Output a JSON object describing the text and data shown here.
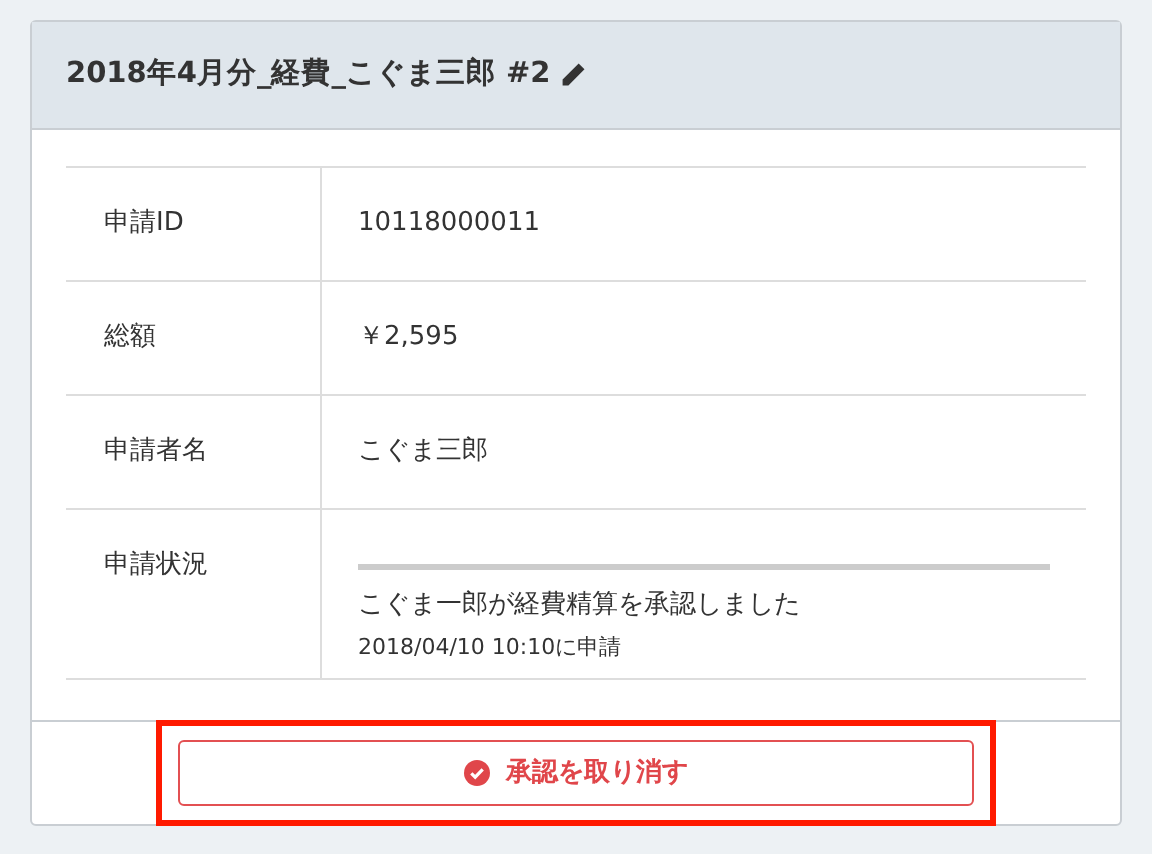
{
  "card": {
    "title": "2018年4月分_経費_こぐま三郎 #2"
  },
  "details": [
    {
      "label": "申請ID",
      "value": "10118000011"
    },
    {
      "label": "総額",
      "value": "￥2,595"
    },
    {
      "label": "申請者名",
      "value": "こぐま三郎"
    }
  ],
  "status": {
    "label": "申請状況",
    "message": "こぐま一郎が経費精算を承認しました",
    "timestamp": "2018/04/10 10:10に申請"
  },
  "action_button": {
    "label": "承認を取り消す",
    "highlighted": true
  }
}
